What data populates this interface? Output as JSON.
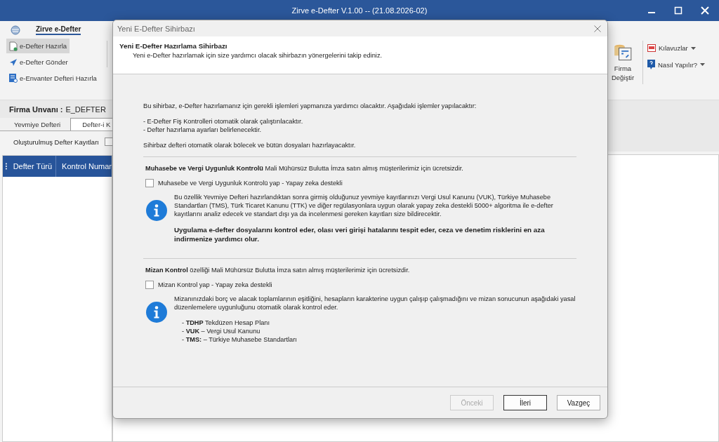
{
  "window": {
    "title": "Zirve e-Defter V.1.00  -- (21.08.2026-02)"
  },
  "ribbon": {
    "app_tab": "Zirve e-Defter",
    "left_buttons": [
      {
        "label": "e-Defter Hazırla",
        "selected": true,
        "kind": "doc"
      },
      {
        "label": "e-Defter Gönder",
        "selected": false,
        "kind": "send"
      },
      {
        "label": "e-Envanter Defteri Hazırla",
        "selected": false,
        "kind": "inventory"
      }
    ],
    "big_button": "Firma Değiştir",
    "menus": [
      {
        "label": "Kılavuzlar",
        "kind": "pdf"
      },
      {
        "label": "Nasıl Yapılır?",
        "kind": "help"
      }
    ]
  },
  "company": {
    "label": "Firma Unvanı :",
    "value": "E_DEFTER"
  },
  "tabs": [
    {
      "label": "Yevmiye Defteri",
      "selected": false
    },
    {
      "label": "Defter-i K",
      "selected": true
    }
  ],
  "filter": {
    "label": "Oluşturulmuş Defter Kayıtları",
    "checked": false
  },
  "table": {
    "columns": [
      "Defter Türü",
      "Kontrol Numar"
    ]
  },
  "dialog": {
    "title": "Yeni E-Defter Sihirbazı",
    "header_title": "Yeni E-Defter Hazırlama Sihirbazı",
    "header_subtitle": "Yeni e-Defter hazırlamak için size yardımcı olacak sihirbazın yönergelerini takip ediniz.",
    "intro": "Bu sihirbaz, e-Defter hazırlamanız için gerekli işlemleri yapmanıza yardımcı olacaktır. Aşağıdaki işlemler yapılacaktır:",
    "bullets": [
      "- E-Defter Fiş Kontrolleri otomatik olarak çalıştırılacaktır.",
      "- Defter hazırlama ayarları belirlenecektir."
    ],
    "outro": "Sihirbaz defteri otomatik olarak bölecek ve bütün dosyaları hazırlayacaktır.",
    "sections": [
      {
        "heading": "**Muhasebe ve Vergi Uygunluk Kontrolü** Mali Mühürsüz Bulutta İmza satın almış müşterilerimiz için ücretsizdir.",
        "checkbox": {
          "label": "Muhasebe ve Vergi Uygunluk Kontrolü yap - Yapay zeka destekli",
          "checked": false
        },
        "info": [
          {
            "kind": "text",
            "text": "Bu özellik Yevmiye Defteri hazırlandıktan sonra girmiş olduğunuz yevmiye kayıtlarınızı Vergi Usul Kanunu (VUK), Türkiye Muhasebe Standartları (TMS), Türk Ticaret Kanunu (TTK) ve diğer regülasyonlara uygun olarak yapay zeka destekli 5000+ algoritma ile e-defter kayıtlarını analiz edecek ve standart dışı ya da incelenmesi gereken kayıtları size bildirecektir."
          },
          {
            "kind": "bold",
            "text": "Uygulama e-defter dosyalarını kontrol eder, olası veri girişi hatalarını tespit eder, ceza ve denetim risklerini en aza indirmenize yardımcı olur."
          }
        ]
      },
      {
        "heading": "**Mizan Kontrol** özelliği Mali Mühürsüz Bulutta İmza satın almış müşterilerimiz için ücretsizdir.",
        "checkbox": {
          "label": "Mizan Kontrol yap - Yapay zeka destekli",
          "checked": false
        },
        "info": [
          {
            "kind": "text",
            "text": "Mizanınızdaki borç ve alacak toplamlarının eşitliğini, hesapların karakterine uygun çalışıp çalışmadığını ve mizan sonucunun aşağıdaki yasal düzenlemelere uygunluğunu otomatik olarak kontrol eder."
          },
          {
            "kind": "list",
            "items": [
              "- **TDHP** Tekdüzen Hesap Planı",
              "- **VUK** – Vergi Usul Kanunu",
              "- **TMS:** – Türkiye Muhasebe Standartları"
            ]
          }
        ]
      }
    ],
    "buttons": [
      {
        "label": "Önceki",
        "disabled": true,
        "default": false
      },
      {
        "label": "İleri",
        "disabled": false,
        "default": true
      },
      {
        "label": "Vazgeç",
        "disabled": false,
        "default": false
      }
    ]
  }
}
